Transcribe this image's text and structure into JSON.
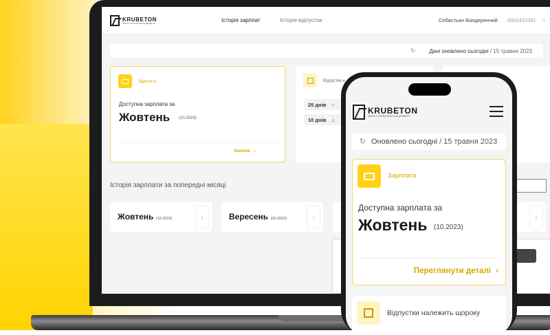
{
  "brand": {
    "name": "KRUBETON",
    "tagline": "ІВАНО-ФРАНКІВСЬКЦЕМЕНТ"
  },
  "nav": {
    "salary_history": "Історія зарплат",
    "vacation_history": "Історія відпусток"
  },
  "user": {
    "name": "Себастьян Вандеренчий",
    "id": "0001432051"
  },
  "update_bar": {
    "prefix": "Дані оновлено сьогодні",
    "date": " / 15 травня 2023"
  },
  "salary_card": {
    "label": "Зарплата",
    "subtitle": "Доступна зарплата за",
    "month": "Жовтень",
    "period": "(10.2023)",
    "button": "Кнопка"
  },
  "vacation_card": {
    "label": "Відпустки н",
    "rows": [
      {
        "days": "25 днів",
        "suffix": "о"
      },
      {
        "days": "10 днів",
        "suffix": "д"
      }
    ]
  },
  "history": {
    "title": "Історія зарплати за попередні місяці",
    "items": [
      {
        "month": "Жовтень",
        "period": "(10.2023)"
      },
      {
        "month": "Вересень",
        "period": "(09.2023)"
      }
    ]
  },
  "phone": {
    "update": {
      "prefix": "Оновлено сьогодні",
      "date": " / 15 травня 2023"
    },
    "salary_card": {
      "label": "Зарплата",
      "subtitle": "Доступна зарплата за",
      "month": "Жовтень",
      "period": "(10.2023)",
      "button": "Переглянути деталі"
    },
    "vacation_card": {
      "label": "Відпустки належить щороку"
    }
  },
  "colors": {
    "accent": "#ffd21a",
    "accent_text": "#d4a800"
  }
}
